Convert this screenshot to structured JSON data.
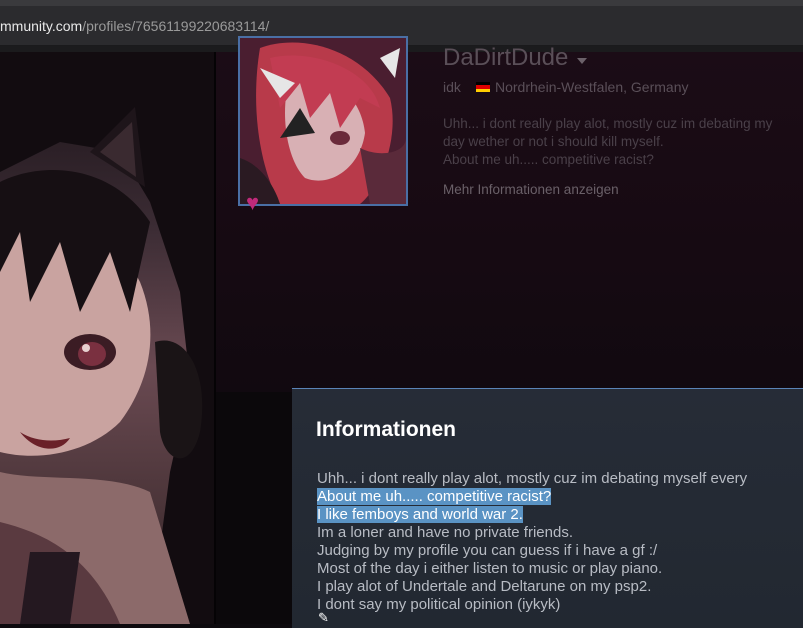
{
  "browser": {
    "url_host": "mmunity.com",
    "url_path": "/profiles/76561199220683114/"
  },
  "profile": {
    "persona_name": "DaDirtDude",
    "real_name": "idk",
    "location": "Nordrhein-Westfalen, Germany",
    "flag_colors": [
      "#000000",
      "#dd0000",
      "#ffce00"
    ],
    "summary_lines": [
      "Uhh... i dont really play alot, mostly cuz im debating my",
      "day wether or not i should kill myself.",
      "About me uh..... competitive racist?"
    ],
    "more_info_label": "Mehr Informationen anzeigen",
    "badge_icon": "heart-icon"
  },
  "modal": {
    "title": "Informationen",
    "lines": [
      {
        "text": "Uhh... i dont really play alot, mostly cuz im debating myself every",
        "selected": false
      },
      {
        "text": "About me uh..... competitive racist?",
        "selected": true
      },
      {
        "text": "I like femboys and world war 2.",
        "selected": true
      },
      {
        "text": "Im a loner and have no private friends.",
        "selected": false
      },
      {
        "text": "Judging by my profile you can guess if i have a gf :/",
        "selected": false
      },
      {
        "text": "Most of the day i either listen to music or play piano.",
        "selected": false
      },
      {
        "text": "I play alot of Undertale and Deltarune on my psp2.",
        "selected": false
      },
      {
        "text": "I dont say my political opinion (iykyk)",
        "selected": false
      }
    ],
    "accent_color": "#5a84b8",
    "selection_color": "#5a93c4"
  }
}
